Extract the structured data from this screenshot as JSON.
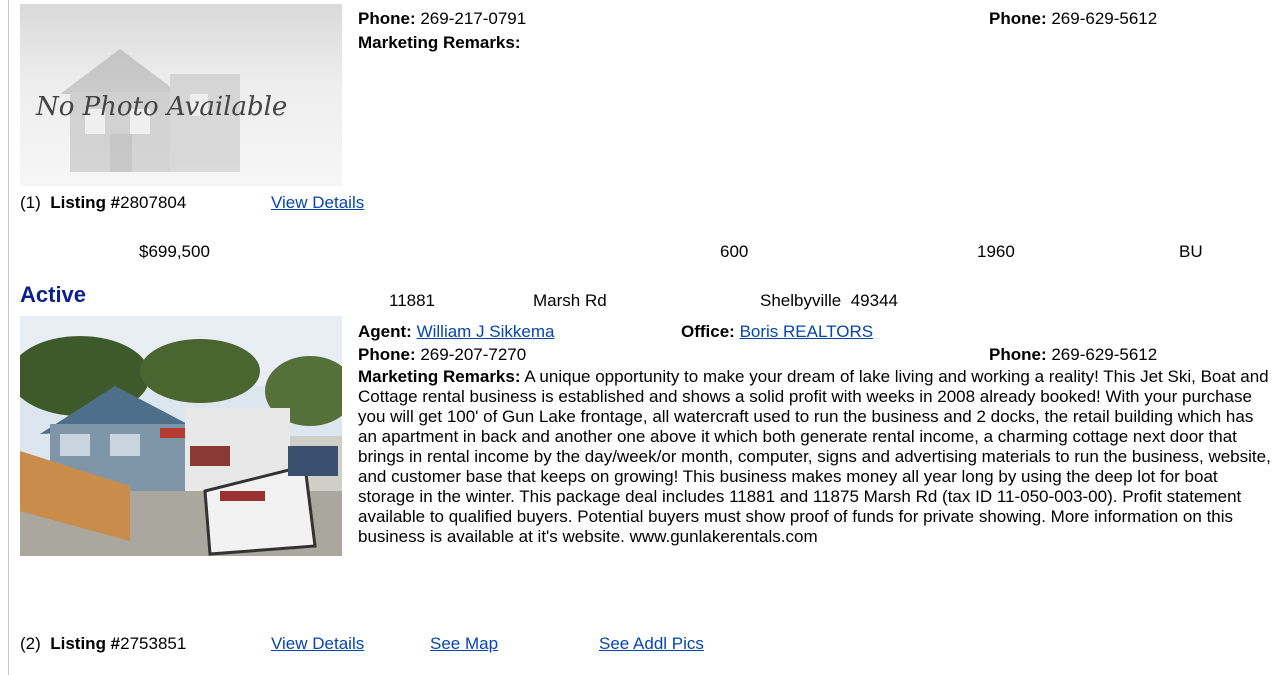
{
  "listing1": {
    "photo_text": "No Photo Available",
    "agent_phone_label": "Phone:",
    "agent_phone": "269-217-0791",
    "office_phone_label": "Phone:",
    "office_phone": "269-629-5612",
    "remarks_label": "Marketing Remarks:",
    "index": "(1)",
    "listing_label": "Listing #",
    "listing_number": "2807804",
    "view_details": "View Details"
  },
  "listing2": {
    "price": "$699,500",
    "sqft": "600",
    "year": "1960",
    "type": "BU",
    "status": "Active",
    "street_number": "11881",
    "street_name": "Marsh Rd",
    "city_zip": "Shelbyville  49344",
    "agent_label": "Agent:",
    "agent_name": "William J Sikkema",
    "office_label": "Office:",
    "office_name": "Boris REALTORS",
    "agent_phone_label": "Phone:",
    "agent_phone": "269-207-7270",
    "office_phone_label": "Phone:",
    "office_phone": "269-629-5612",
    "remarks_label": "Marketing Remarks:",
    "remarks": "A unique opportunity to make your dream of lake living and working a reality! This Jet Ski, Boat and Cottage rental business is established and shows a solid profit with weeks in 2008 already booked! With your purchase you will get 100' of Gun Lake frontage, all watercraft used to run the business and 2 docks, the retail building which has an apartment in back and another one above it which both generate rental income, a charming cottage next door that brings in rental income by the day/week/or month, computer, signs and advertising materials to run the business, website, and customer base that keeps on growing! This business makes money all year long by using the deep lot for boat storage in the winter. This package deal includes 11881 and 11875 Marsh Rd (tax ID 11-050-003-00). Profit statement available to qualified buyers. Potential buyers must show proof of funds for private showing. More information on this business is available at it's website. www.gunlakerentals.com",
    "index": "(2)",
    "listing_label": "Listing #",
    "listing_number": "2753851",
    "view_details": "View Details",
    "see_map": "See Map",
    "see_addl_pics": "See Addl Pics"
  },
  "colors": {
    "link": "#0645ad",
    "status": "#0b1f8f"
  }
}
